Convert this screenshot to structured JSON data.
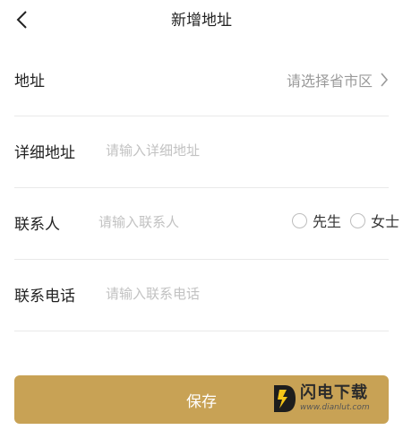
{
  "header": {
    "title": "新增地址"
  },
  "form": {
    "address": {
      "label": "地址",
      "picker_placeholder": "请选择省市区"
    },
    "detail": {
      "label": "详细地址",
      "placeholder": "请输入详细地址"
    },
    "contact": {
      "label": "联系人",
      "placeholder": "请输入联系人",
      "gender_options": [
        "先生",
        "女士"
      ]
    },
    "phone": {
      "label": "联系电话",
      "placeholder": "请输入联系电话"
    }
  },
  "actions": {
    "save_label": "保存"
  },
  "watermark": {
    "name": "闪电下载",
    "url": "www.dianlut.com"
  },
  "colors": {
    "accent": "#c8a255",
    "placeholder": "#c2c2c2",
    "divider": "#e9e9e9"
  },
  "icons": {
    "back": "chevron-left-icon",
    "picker_arrow": "chevron-right-icon",
    "radio": "radio-unchecked-icon",
    "watermark_logo": "lightning-d-logo"
  }
}
